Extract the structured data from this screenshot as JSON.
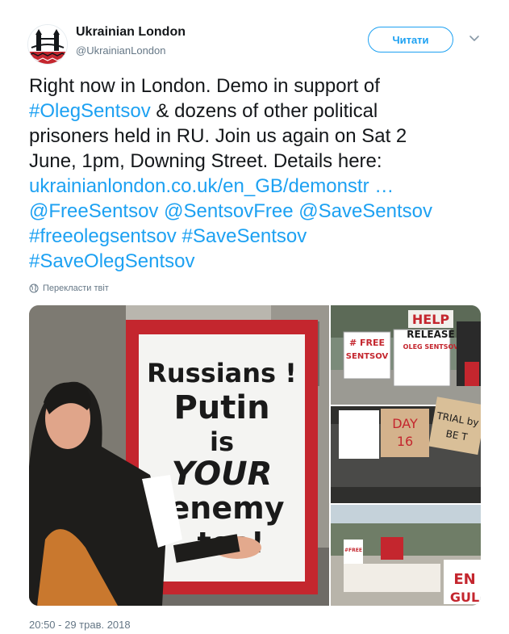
{
  "account": {
    "display_name": "Ukrainian London",
    "screen_name": "@UkrainianLondon"
  },
  "follow_button": {
    "label": "Читати"
  },
  "tweet": {
    "lines": [
      [
        {
          "text": "Right now in London. Demo in support of",
          "link": false
        }
      ],
      [
        {
          "text": "#OlegSentsov",
          "link": true
        },
        {
          "text": " & dozens of other political",
          "link": false
        }
      ],
      [
        {
          "text": "prisoners held in RU. Join us again on Sat 2",
          "link": false
        }
      ],
      [
        {
          "text": "June, 1pm, Downing Street. Details here:",
          "link": false
        }
      ],
      [
        {
          "text": "ukrainianlondon.co.uk/en_GB/demonstr   …",
          "link": true
        }
      ],
      [
        {
          "text": " @FreeSentsov",
          "link": true
        },
        {
          "text": " ",
          "link": false
        },
        {
          "text": "@SentsovFree",
          "link": true
        },
        {
          "text": " ",
          "link": false
        },
        {
          "text": "@SaveSentsov",
          "link": true
        }
      ],
      [
        {
          "text": "#freeolegsentsov",
          "link": true
        },
        {
          "text": " ",
          "link": false
        },
        {
          "text": "#SaveSentsov",
          "link": true
        }
      ],
      [
        {
          "text": "#SaveOlegSentsov",
          "link": true
        }
      ]
    ]
  },
  "translate": {
    "label": "Перекласти твіт",
    "icon": "globe-icon"
  },
  "photos": {
    "main_sign": {
      "line1": "Russians !",
      "line2": "Putin",
      "line3": "is",
      "line4": "YOUR",
      "line5": "enemy",
      "line6": "too!"
    },
    "top_right": {
      "sign_free": "# FREE",
      "sign_sentsov": "SENTSOV",
      "help": "HELP",
      "release": "RELEASE",
      "oleg": "OLEG SENTSOV"
    },
    "middle_right": {
      "day": "DAY",
      "day_num": "16",
      "trial": "TRIAL by",
      "be": "BE T"
    },
    "bottom_right": {
      "free": "#FREE",
      "en": "EN",
      "gul": "GUL"
    }
  },
  "timestamp": "20:50 - 29 трав. 2018",
  "colors": {
    "link": "#1da1f2",
    "secondary": "#657786",
    "sign_red": "#c4262e"
  }
}
